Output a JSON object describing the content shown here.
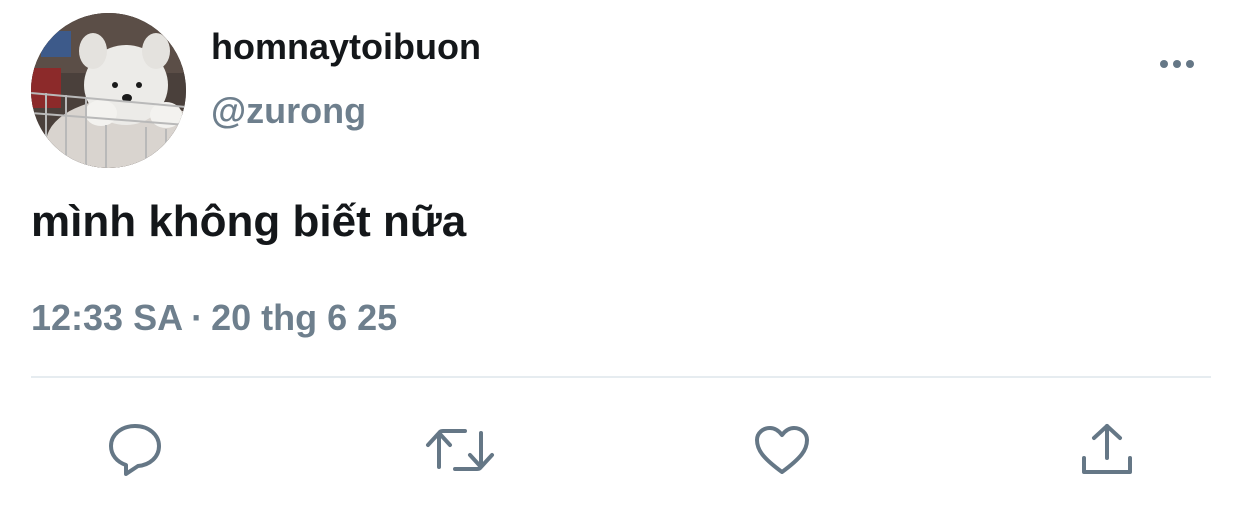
{
  "user": {
    "display_name": "homnaytoibuon",
    "handle": "@zurong"
  },
  "tweet": {
    "text": "mình không biết nữa",
    "time": "12:33 SA",
    "separator": "·",
    "date": "20 thg 6 25"
  },
  "icons": {
    "more": "more-horizontal-icon",
    "reply": "reply-bubble-icon",
    "retweet": "retweet-icon",
    "like": "heart-icon",
    "share": "share-upload-icon"
  },
  "colors": {
    "text_primary": "#14171a",
    "text_secondary": "#6e7f8d",
    "icon": "#657786",
    "divider": "#e6ecf0",
    "background": "#ffffff"
  }
}
